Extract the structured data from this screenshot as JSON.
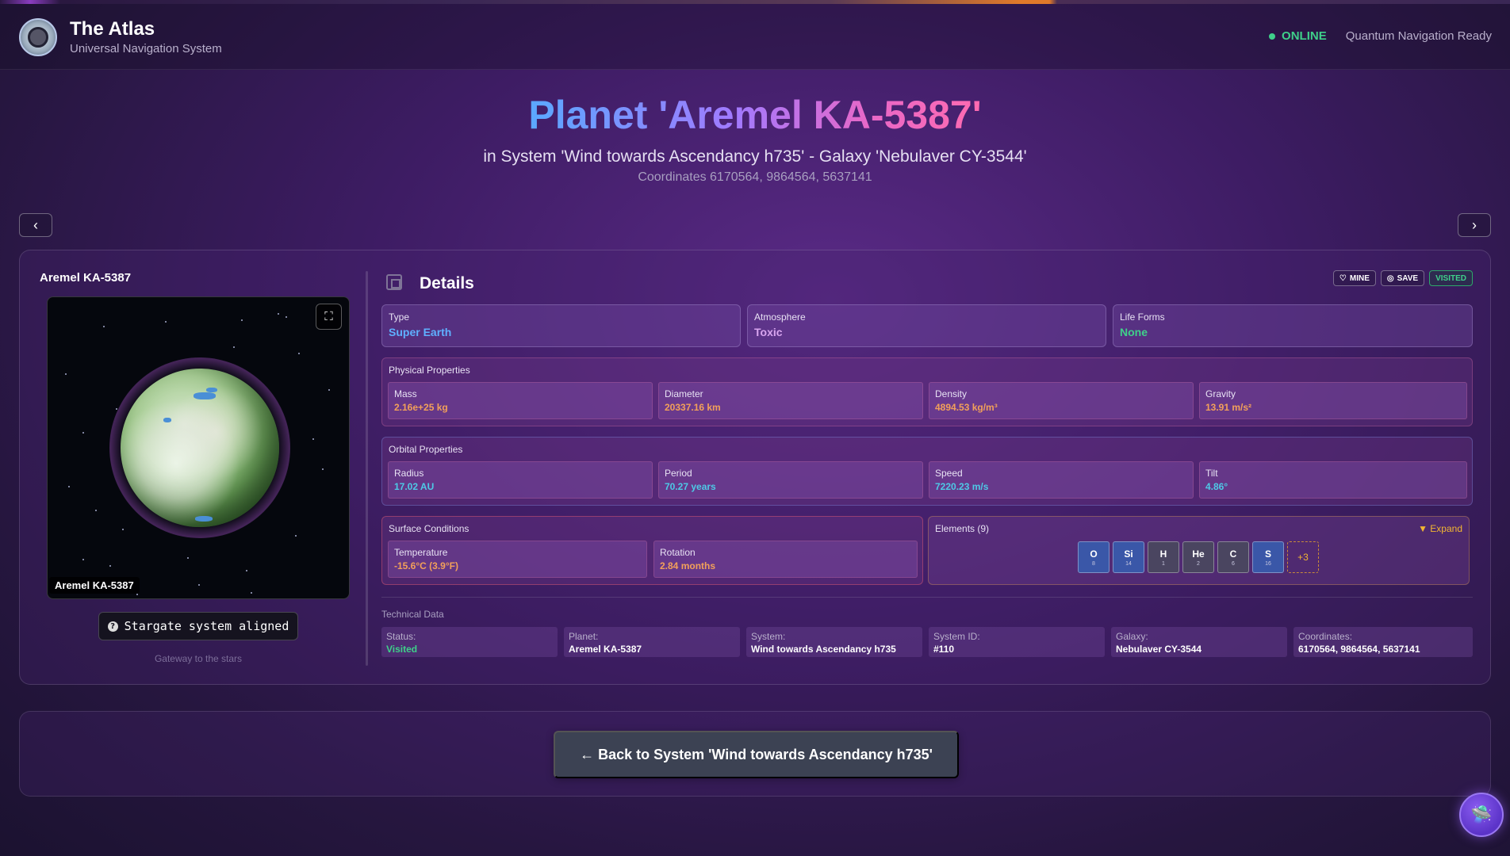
{
  "header": {
    "title": "The Atlas",
    "subtitle": "Universal Navigation System",
    "status": "ONLINE",
    "status_message": "Quantum Navigation Ready"
  },
  "hero": {
    "title": "Planet 'Aremel KA-5387'",
    "subtitle": "in System 'Wind towards Ascendancy h735' - Galaxy 'Nebulaver CY-3544'",
    "coordinates": "Coordinates 6170564, 9864564, 5637141"
  },
  "nav": {
    "prev_icon": "‹",
    "next_icon": "›"
  },
  "viewer": {
    "planet_name": "Aremel KA-5387",
    "caption": "Aremel KA-5387",
    "expand_icon": "⛶",
    "stargate_label": "Stargate system aligned",
    "stargate_icon": "?",
    "gateway_text": "Gateway to the stars"
  },
  "details": {
    "title": "Details",
    "actions": {
      "mine": "MINE",
      "save": "SAVE",
      "visited": "VISITED"
    },
    "type": {
      "label": "Type",
      "value": "Super Earth"
    },
    "atmosphere": {
      "label": "Atmosphere",
      "value": "Toxic"
    },
    "life_forms": {
      "label": "Life Forms",
      "value": "None"
    }
  },
  "physical": {
    "title": "Physical Properties",
    "items": [
      {
        "label": "Mass",
        "value": "2.16e+25 kg"
      },
      {
        "label": "Diameter",
        "value": "20337.16 km"
      },
      {
        "label": "Density",
        "value": "4894.53 kg/m³"
      },
      {
        "label": "Gravity",
        "value": "13.91 m/s²"
      }
    ]
  },
  "orbital": {
    "title": "Orbital Properties",
    "items": [
      {
        "label": "Radius",
        "value": "17.02 AU"
      },
      {
        "label": "Period",
        "value": "70.27 years"
      },
      {
        "label": "Speed",
        "value": "7220.23 m/s"
      },
      {
        "label": "Tilt",
        "value": "4.86°"
      }
    ]
  },
  "surface": {
    "title": "Surface Conditions",
    "items": [
      {
        "label": "Temperature",
        "value": "-15.6°C (3.9°F)"
      },
      {
        "label": "Rotation",
        "value": "2.84 months"
      }
    ]
  },
  "elements": {
    "title": "Elements (9)",
    "expand": "▼ Expand",
    "items": [
      {
        "symbol": "O",
        "number": "8"
      },
      {
        "symbol": "Si",
        "number": "14"
      },
      {
        "symbol": "H",
        "number": "1"
      },
      {
        "symbol": "He",
        "number": "2"
      },
      {
        "symbol": "C",
        "number": "6"
      },
      {
        "symbol": "S",
        "number": "16"
      }
    ],
    "more": "+3"
  },
  "technical": {
    "title": "Technical Data",
    "items": [
      {
        "label": "Status:",
        "value": "Visited"
      },
      {
        "label": "Planet:",
        "value": "Aremel KA-5387"
      },
      {
        "label": "System:",
        "value": "Wind towards Ascendancy h735"
      },
      {
        "label": "System ID:",
        "value": "#110"
      },
      {
        "label": "Galaxy:",
        "value": "Nebulaver CY-3544"
      },
      {
        "label": "Coordinates:",
        "value": "6170564, 9864564, 5637141"
      }
    ]
  },
  "back_button": "← Back to System 'Wind towards Ascendancy h735'",
  "colors": {
    "accent_blue": "#5aa8ff",
    "accent_pink": "#ff6ab0",
    "online_green": "#3fd08a",
    "value_orange": "#f2a05a",
    "value_cyan": "#4ec9e6",
    "expand_gold": "#f2b632"
  }
}
